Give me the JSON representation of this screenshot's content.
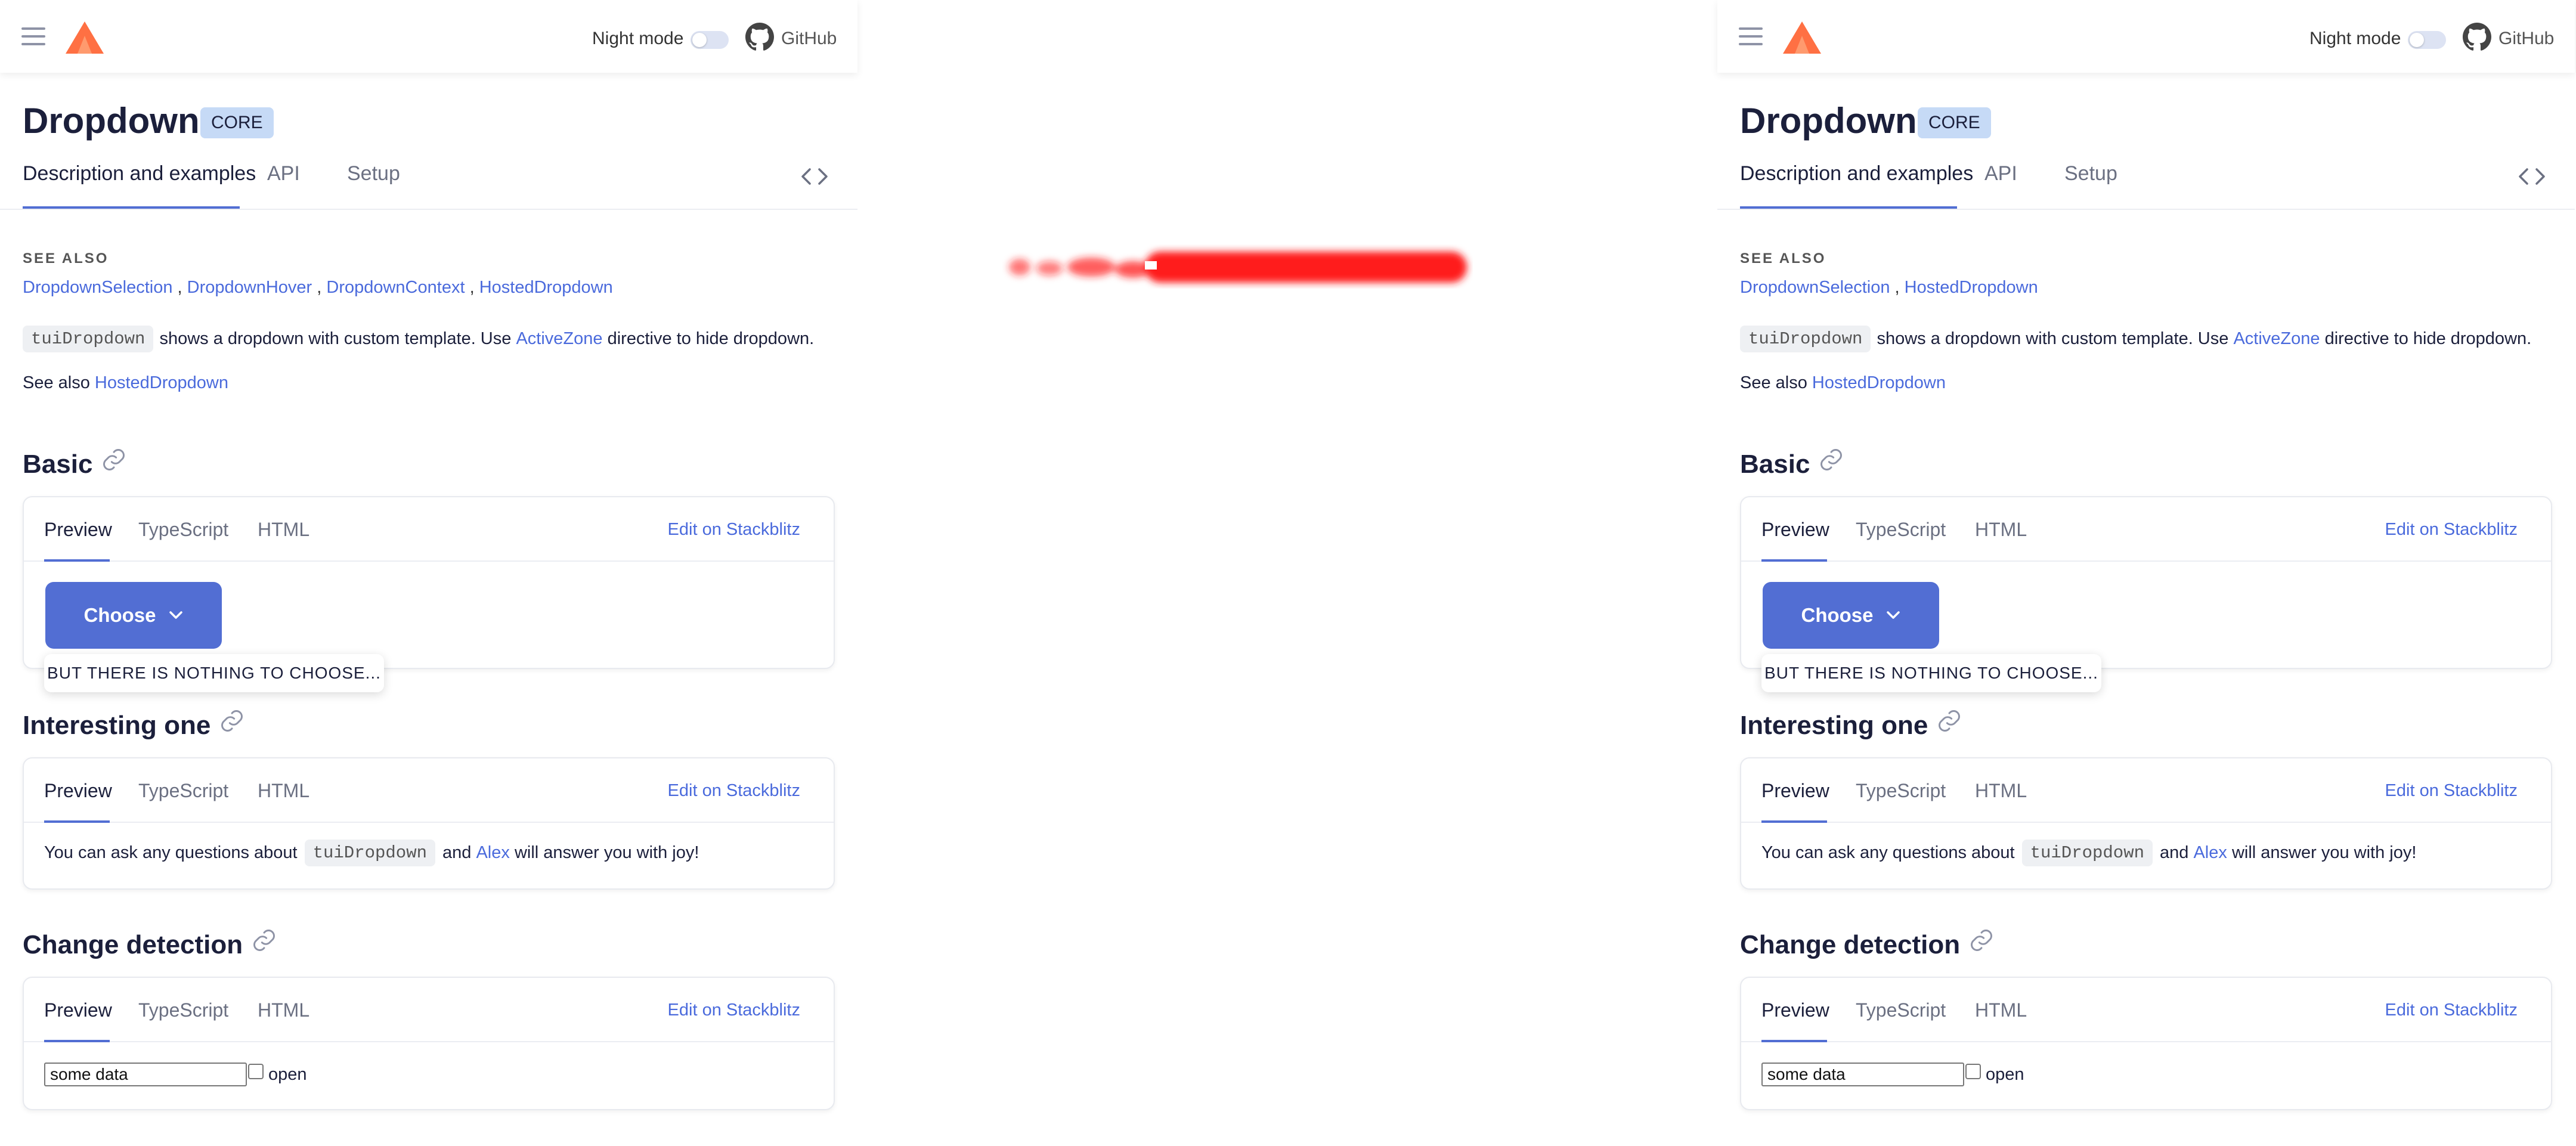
{
  "topbar": {
    "night_mode_label": "Night mode",
    "github_label": "GitHub"
  },
  "header": {
    "title": "Dropdown",
    "badge": "CORE"
  },
  "tabs": [
    {
      "label": "Description and examples"
    },
    {
      "label": "API"
    },
    {
      "label": "Setup"
    }
  ],
  "see_also": {
    "heading": "SEE ALSO",
    "left_links": [
      "DropdownSelection",
      "DropdownHover",
      "DropdownContext",
      "HostedDropdown"
    ],
    "right_links": [
      "DropdownSelection",
      "HostedDropdown"
    ]
  },
  "description": {
    "code": "tuiDropdown",
    "text_before": "shows a dropdown with custom template. Use",
    "link": "ActiveZone",
    "text_after": "directive to hide dropdown."
  },
  "see_also_line": {
    "prefix": "See also",
    "link": "HostedDropdown"
  },
  "card_tabs": {
    "preview": "Preview",
    "typescript": "TypeScript",
    "html": "HTML",
    "stackblitz": "Edit on Stackblitz"
  },
  "basic": {
    "heading": "Basic",
    "button": "Choose",
    "dropdown_text": "BUT THERE IS NOTHING TO CHOOSE..."
  },
  "interesting": {
    "heading": "Interesting one",
    "text_before": "You can ask any questions about",
    "code": "tuiDropdown",
    "and": "and",
    "link": "Alex",
    "text_after": "will answer you with joy!"
  },
  "change_detection": {
    "heading": "Change detection",
    "input_value": "some data",
    "checkbox_label": "open"
  },
  "colors": {
    "accent": "#526ed3",
    "link": "#4a6adc",
    "badge_bg": "#c6daf6",
    "logo": "#ff7043"
  }
}
